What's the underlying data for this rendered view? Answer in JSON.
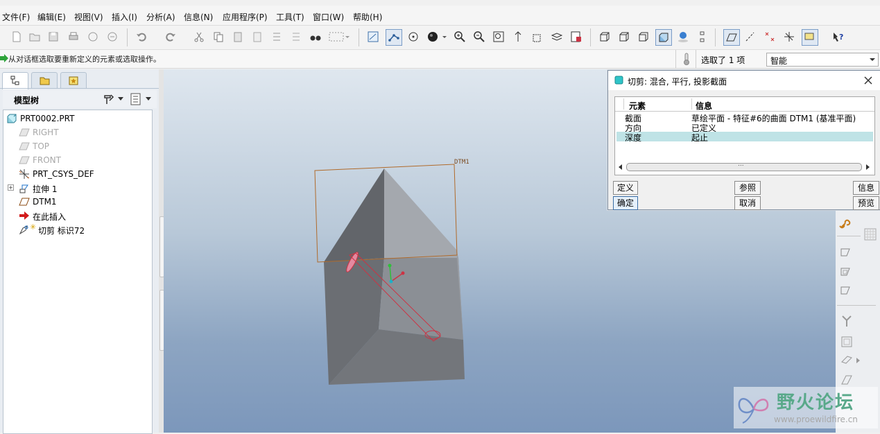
{
  "menu": [
    "文件(F)",
    "编辑(E)",
    "视图(V)",
    "插入(I)",
    "分析(A)",
    "信息(N)",
    "应用程序(P)",
    "工具(T)",
    "窗口(W)",
    "帮助(H)"
  ],
  "message": "从对话框选取要重新定义的元素或选取操作。",
  "selection": {
    "count_text": "选取了 1 项",
    "filter": "智能"
  },
  "model_tree": {
    "title": "模型树",
    "items": [
      {
        "label": "PRT0002.PRT",
        "icon": "part-icon",
        "state": "normal"
      },
      {
        "label": "RIGHT",
        "icon": "datum-plane-icon",
        "state": "hidden"
      },
      {
        "label": "TOP",
        "icon": "datum-plane-icon",
        "state": "hidden"
      },
      {
        "label": "FRONT",
        "icon": "datum-plane-icon",
        "state": "hidden"
      },
      {
        "label": "PRT_CSYS_DEF",
        "icon": "csys-icon",
        "state": "normal"
      },
      {
        "label": "拉伸 1",
        "icon": "extrude-icon",
        "state": "normal"
      },
      {
        "label": "DTM1",
        "icon": "datum-plane-icon",
        "state": "normal"
      },
      {
        "label": "在此插入",
        "icon": "insert-arrow-icon",
        "state": "normal"
      },
      {
        "label": "切剪 标识72",
        "icon": "cut-feature-icon",
        "state": "normal"
      }
    ]
  },
  "viewport": {
    "datum_label": "DTM1"
  },
  "dialog": {
    "title": "切剪: 混合, 平行, 投影截面",
    "columns": [
      "元素",
      "信息"
    ],
    "rows": [
      {
        "element": "截面",
        "info": "草绘平面 - 特征#6的曲面 DTM1 (基准平面)"
      },
      {
        "element": "方向",
        "info": "已定义"
      },
      {
        "element": "深度",
        "info": "起止"
      }
    ],
    "selected_row": 2,
    "scroll_grip": "...",
    "buttons": {
      "define": "定义",
      "refs": "参照",
      "info": "信息",
      "ok": "确定",
      "cancel": "取消",
      "preview": "预览"
    }
  },
  "watermark": {
    "title": "野火论坛",
    "url": "www.proewildfire.cn"
  },
  "colors": {
    "accent": "#4b8fc7",
    "selection_row": "#bfe3e6",
    "model_face_dark": "#6b6e73",
    "model_face_light": "#a4a8ae",
    "datum": "#b06a2a",
    "cut_sketch": "#cc3344"
  }
}
